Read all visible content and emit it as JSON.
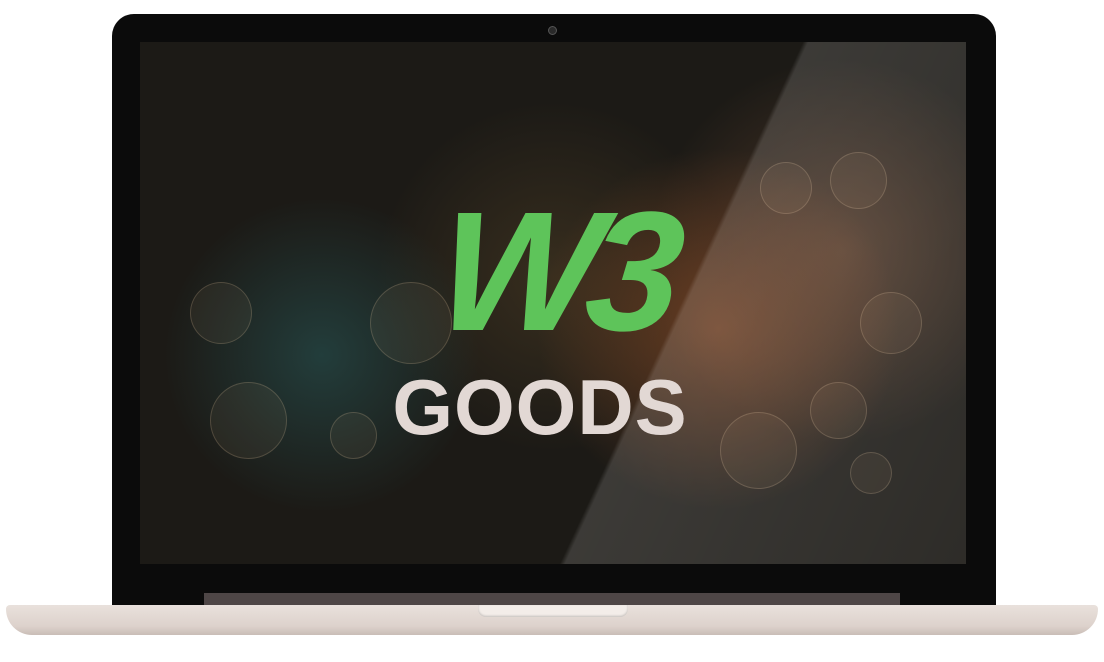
{
  "logo": {
    "top_text": "W3",
    "bottom_text": "GOODS",
    "colors": {
      "top": "#5ec45a",
      "bottom": "#e2d8d4"
    }
  },
  "device": "laptop-icon"
}
